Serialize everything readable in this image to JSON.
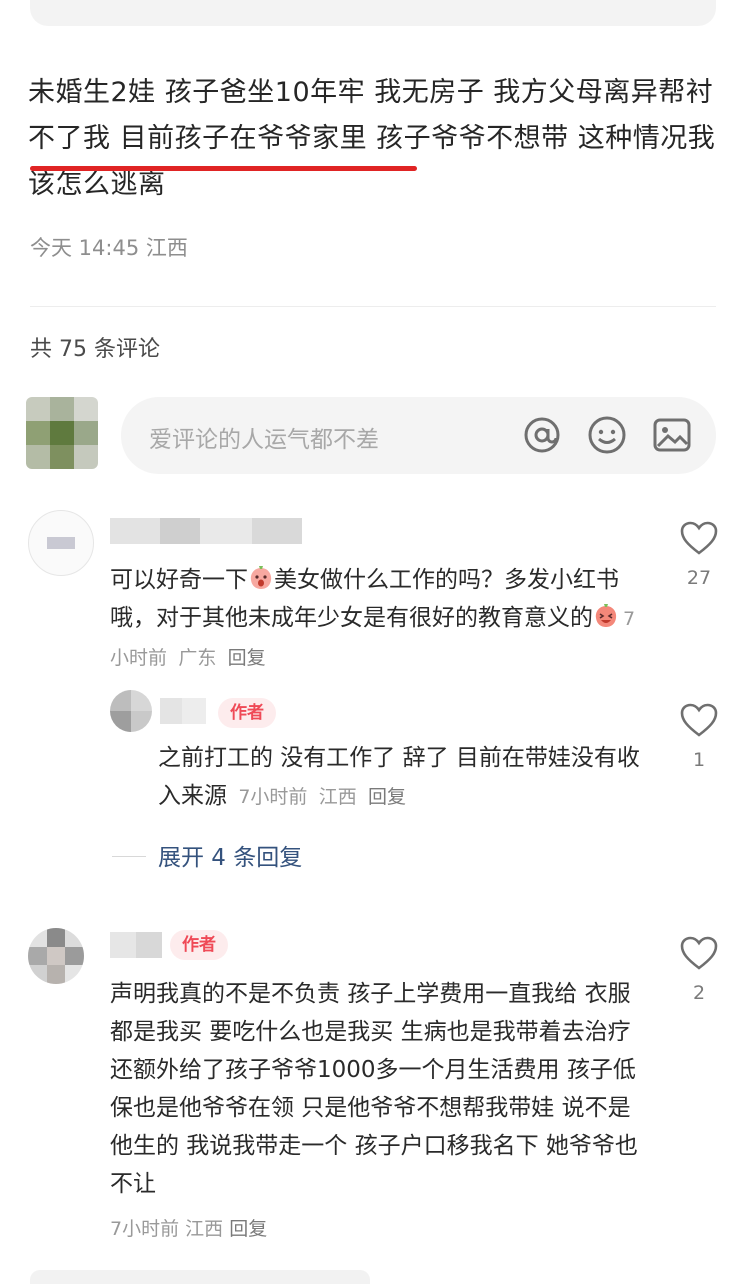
{
  "post": {
    "text": "未婚生2娃 孩子爸坐10年牢 我无房子 我方父母离异帮衬不了我 目前孩子在爷爷家里 孩子爷爷不想带 这种情况我该怎么逃离",
    "time": "今天 14:45",
    "location": "江西"
  },
  "comments_header": {
    "count_label": "共 75 条评论"
  },
  "comment_input": {
    "placeholder": "爱评论的人运气都不差",
    "icons": [
      "at-icon",
      "emoji-icon",
      "image-icon"
    ]
  },
  "comments": [
    {
      "text_a": "可以好奇一下",
      "text_b": "美女做什么工作的吗？多发小红书哦，对于其他未成年少女是有很好的教育意义的",
      "time": "7小时前",
      "location": "广东",
      "reply_label": "回复",
      "likes": "27",
      "replies": [
        {
          "author_tag": "作者",
          "text": "之前打工的 没有工作了 辞了 目前在带娃没有收入来源",
          "time": "7小时前",
          "location": "江西",
          "reply_label": "回复",
          "likes": "1"
        }
      ],
      "expand_label": "展开 4 条回复"
    },
    {
      "author_tag": "作者",
      "text": "声明我真的不是不负责 孩子上学费用一直我给 衣服都是我买 要吃什么也是我买 生病也是我带着去治疗 还额外给了孩子爷爷1000多一个月生活费用 孩子低保也是他爷爷在领 只是他爷爷不想帮我带娃 说不是他生的 我说我带走一个 孩子户口移我名下 她爷爷也不让",
      "time": "7小时前",
      "location": "江西",
      "reply_label": "回复",
      "likes": "2"
    }
  ],
  "colors": {
    "accent_red": "#e02424",
    "author_tag_bg": "#fdeced",
    "author_tag_fg": "#ef4a57",
    "link_blue": "#34527d"
  }
}
